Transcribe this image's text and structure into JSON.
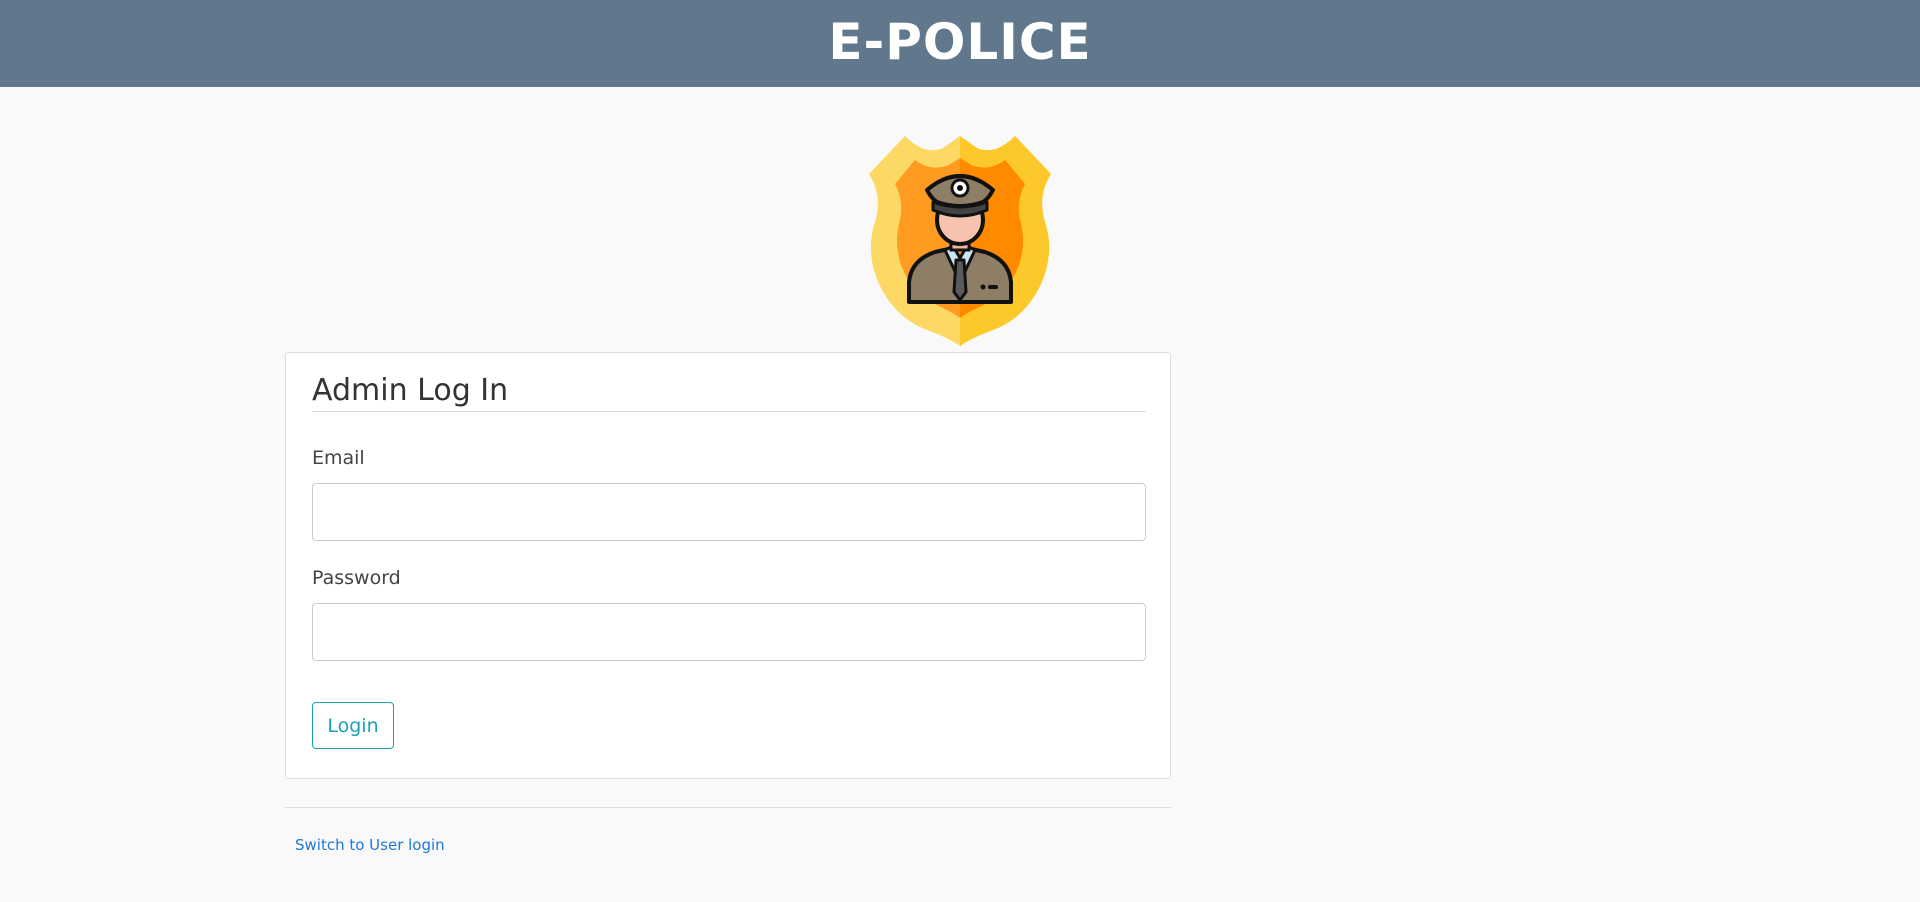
{
  "header": {
    "title": "E-POLICE"
  },
  "logo": {
    "icon": "police-officer-badge-icon"
  },
  "login_form": {
    "title": "Admin Log In",
    "email_label": "Email",
    "email_value": "",
    "password_label": "Password",
    "password_value": "",
    "submit_label": "Login"
  },
  "footer": {
    "switch_link": "Switch to User login"
  },
  "colors": {
    "header_bg": "#61788c",
    "accent": "#17a2b8",
    "link": "#1e7ad6"
  }
}
